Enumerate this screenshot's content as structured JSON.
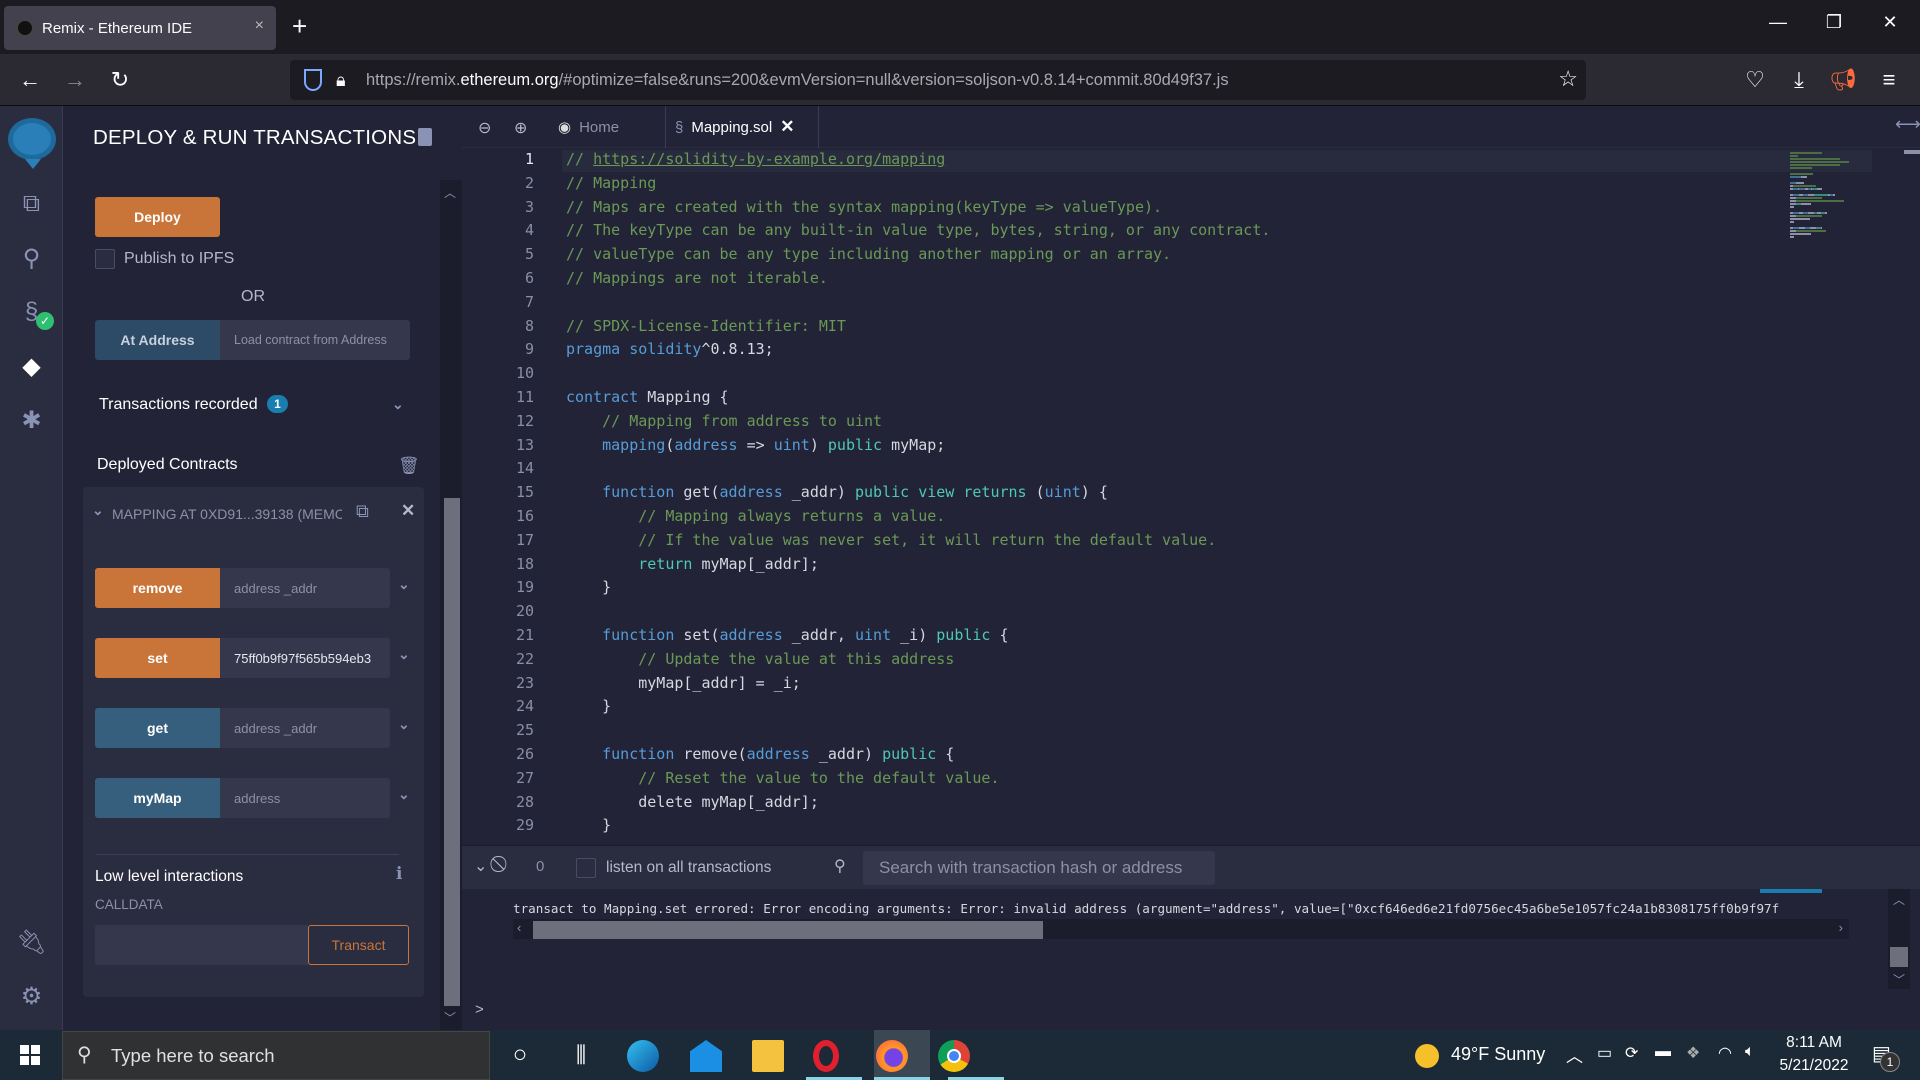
{
  "browser": {
    "tab_title": "Remix - Ethereum IDE",
    "tab_close": "×",
    "new_tab": "+",
    "window_controls": {
      "minimize": "—",
      "restore": "❐",
      "close": "✕"
    },
    "url_prefix": "https://remix.",
    "url_host": "ethereum.org",
    "url_rest": "/#optimize=false&runs=200&evmVersion=null&version=soljson-v0.8.14+commit.80d49f37.js",
    "icons": [
      "back-icon",
      "forward-icon",
      "reload-icon",
      "shield-icon",
      "lock-icon",
      "star-icon",
      "pocket-icon",
      "download-icon",
      "announce-icon",
      "menu-icon"
    ]
  },
  "sidebar_icons": [
    "remix-logo",
    "file-explorer-icon",
    "search-icon",
    "solidity-compiler-icon",
    "deploy-run-icon",
    "debugger-icon",
    "plugin-manager-icon",
    "settings-icon"
  ],
  "panel": {
    "title": "DEPLOY & RUN TRANSACTIONS",
    "deploy_label": "Deploy",
    "publish_ipfs_label": "Publish to IPFS",
    "publish_ipfs_checked": false,
    "or_label": "OR",
    "at_address_label": "At Address",
    "at_address_placeholder": "Load contract from Address",
    "transactions_recorded_label": "Transactions recorded",
    "transactions_recorded_count": "1",
    "deployed_contracts_label": "Deployed Contracts",
    "contract_instance_label": "MAPPING AT 0XD91...39138 (MEMC",
    "functions": [
      {
        "name": "remove",
        "type": "transact",
        "input_value": "",
        "input_placeholder": "address _addr"
      },
      {
        "name": "set",
        "type": "transact",
        "input_value": "75ff0b9f97f565b594eb3",
        "input_placeholder": ""
      },
      {
        "name": "get",
        "type": "call",
        "input_value": "",
        "input_placeholder": "address _addr"
      },
      {
        "name": "myMap",
        "type": "call",
        "input_value": "",
        "input_placeholder": "address"
      }
    ],
    "low_level_label": "Low level interactions",
    "calldata_label": "CALLDATA",
    "calldata_value": "",
    "transact_label": "Transact"
  },
  "editor": {
    "tabs": [
      {
        "label": "Home",
        "active": false
      },
      {
        "label": "Mapping.sol",
        "active": true
      }
    ],
    "lines": [
      [
        [
          "c-com",
          "// "
        ],
        [
          "c-link",
          "https://solidity-by-example.org/mapping"
        ]
      ],
      [
        [
          "c-com",
          "// Mapping"
        ]
      ],
      [
        [
          "c-com",
          "// Maps are created with the syntax mapping(keyType => valueType)."
        ]
      ],
      [
        [
          "c-com",
          "// The keyType can be any built-in value type, bytes, string, or any contract."
        ]
      ],
      [
        [
          "c-com",
          "// valueType can be any type including another mapping or an array."
        ]
      ],
      [
        [
          "c-com",
          "// Mappings are not iterable."
        ]
      ],
      [],
      [
        [
          "c-com",
          "// SPDX-License-Identifier: MIT"
        ]
      ],
      [
        [
          "c-kw",
          "pragma solidity"
        ],
        [
          "",
          "^0.8.13;"
        ]
      ],
      [],
      [
        [
          "c-kw",
          "contract"
        ],
        [
          "",
          " Mapping {"
        ]
      ],
      [
        [
          "",
          "    "
        ],
        [
          "c-com",
          "// Mapping from address to uint"
        ]
      ],
      [
        [
          "",
          "    "
        ],
        [
          "c-kw",
          "mapping"
        ],
        [
          "",
          "("
        ],
        [
          "c-kw",
          "address"
        ],
        [
          "",
          " => "
        ],
        [
          "c-kw",
          "uint"
        ],
        [
          "",
          ") "
        ],
        [
          "c-kw2",
          "public"
        ],
        [
          "",
          " myMap;"
        ]
      ],
      [],
      [
        [
          "",
          "    "
        ],
        [
          "c-kw",
          "function"
        ],
        [
          "",
          " get("
        ],
        [
          "c-kw",
          "address"
        ],
        [
          "",
          " _addr) "
        ],
        [
          "c-kw2",
          "public view returns"
        ],
        [
          "",
          " ("
        ],
        [
          "c-kw",
          "uint"
        ],
        [
          "",
          ") {"
        ]
      ],
      [
        [
          "",
          "        "
        ],
        [
          "c-com",
          "// Mapping always returns a value."
        ]
      ],
      [
        [
          "",
          "        "
        ],
        [
          "c-com",
          "// If the value was never set, it will return the default value."
        ]
      ],
      [
        [
          "",
          "        "
        ],
        [
          "c-kw2",
          "return"
        ],
        [
          "",
          " myMap[_addr];"
        ]
      ],
      [
        [
          "",
          "    }"
        ]
      ],
      [],
      [
        [
          "",
          "    "
        ],
        [
          "c-kw",
          "function"
        ],
        [
          "",
          " set("
        ],
        [
          "c-kw",
          "address"
        ],
        [
          "",
          " _addr, "
        ],
        [
          "c-kw",
          "uint"
        ],
        [
          "",
          " _i) "
        ],
        [
          "c-kw2",
          "public"
        ],
        [
          "",
          " {"
        ]
      ],
      [
        [
          "",
          "        "
        ],
        [
          "c-com",
          "// Update the value at this address"
        ]
      ],
      [
        [
          "",
          "        myMap[_addr] = _i;"
        ]
      ],
      [
        [
          "",
          "    }"
        ]
      ],
      [],
      [
        [
          "",
          "    "
        ],
        [
          "c-kw",
          "function"
        ],
        [
          "",
          " remove("
        ],
        [
          "c-kw",
          "address"
        ],
        [
          "",
          " _addr) "
        ],
        [
          "c-kw2",
          "public"
        ],
        [
          "",
          " {"
        ]
      ],
      [
        [
          "",
          "        "
        ],
        [
          "c-com",
          "// Reset the value to the default value."
        ]
      ],
      [
        [
          "",
          "        delete myMap[_addr];"
        ]
      ],
      [
        [
          "",
          "    }"
        ]
      ]
    ]
  },
  "terminal": {
    "pending_count": "0",
    "listen_label": "listen on all transactions",
    "listen_checked": false,
    "search_placeholder": "Search with transaction hash or address",
    "log": "transact to Mapping.set errored: Error encoding arguments: Error: invalid address (argument=\"address\", value=[\"0xcf646ed6e21fd0756ec45a6be5e1057fc24a1b8308175ff0b9f97f",
    "prompt": ">"
  },
  "taskbar": {
    "search_placeholder": "Type here to search",
    "apps": [
      "cortana-icon",
      "task-view-icon",
      "edge-icon",
      "mail-icon",
      "file-explorer-icon",
      "opera-icon",
      "firefox-icon",
      "chrome-icon"
    ],
    "weather": "49°F  Sunny",
    "time": "8:11 AM",
    "date": "5/21/2022",
    "notification_count": "1"
  }
}
